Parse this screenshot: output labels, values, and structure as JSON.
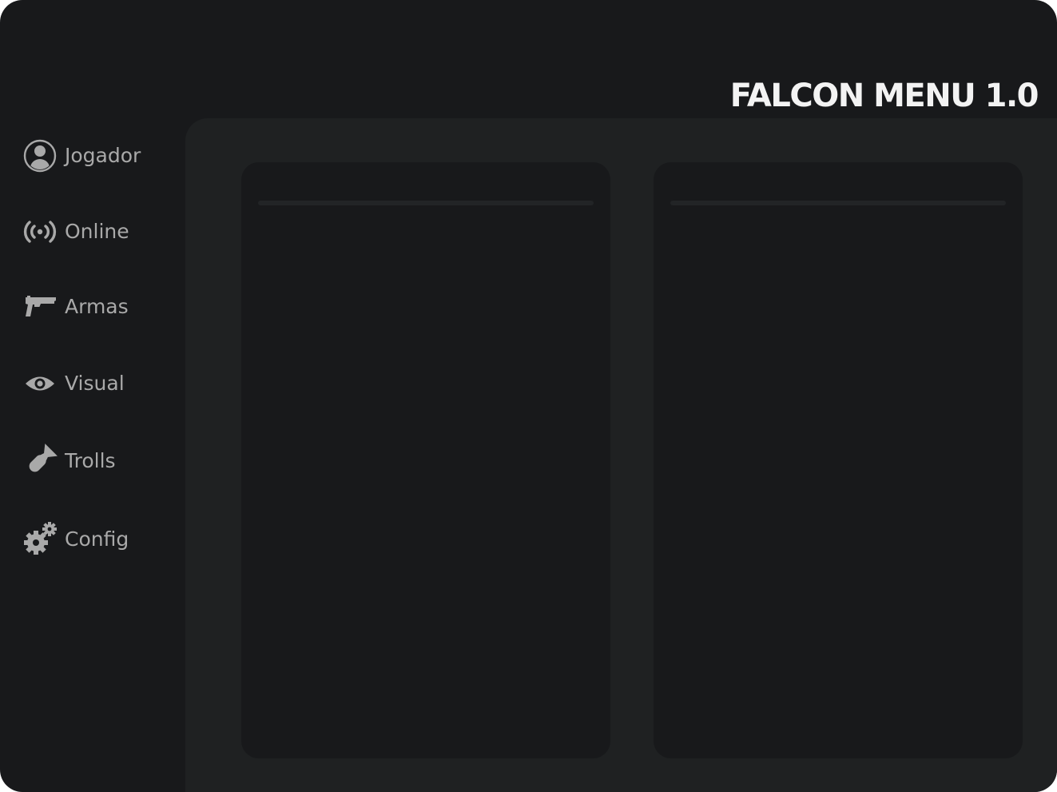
{
  "app": {
    "title": "FALCON MENU 1.0"
  },
  "sidebar": {
    "items": [
      {
        "label": "Jogador",
        "icon": "user-icon"
      },
      {
        "label": "Online",
        "icon": "broadcast-icon"
      },
      {
        "label": "Armas",
        "icon": "pistol-icon"
      },
      {
        "label": "Visual",
        "icon": "eye-icon"
      },
      {
        "label": "Trolls",
        "icon": "bomb-icon"
      },
      {
        "label": "Config",
        "icon": "gears-icon"
      }
    ]
  },
  "colors": {
    "window_bg": "#18191b",
    "content_bg": "#1f2122",
    "panel_bg": "#18191b",
    "nav_text": "#a9a9a9",
    "title_text": "#f3f3f3"
  }
}
